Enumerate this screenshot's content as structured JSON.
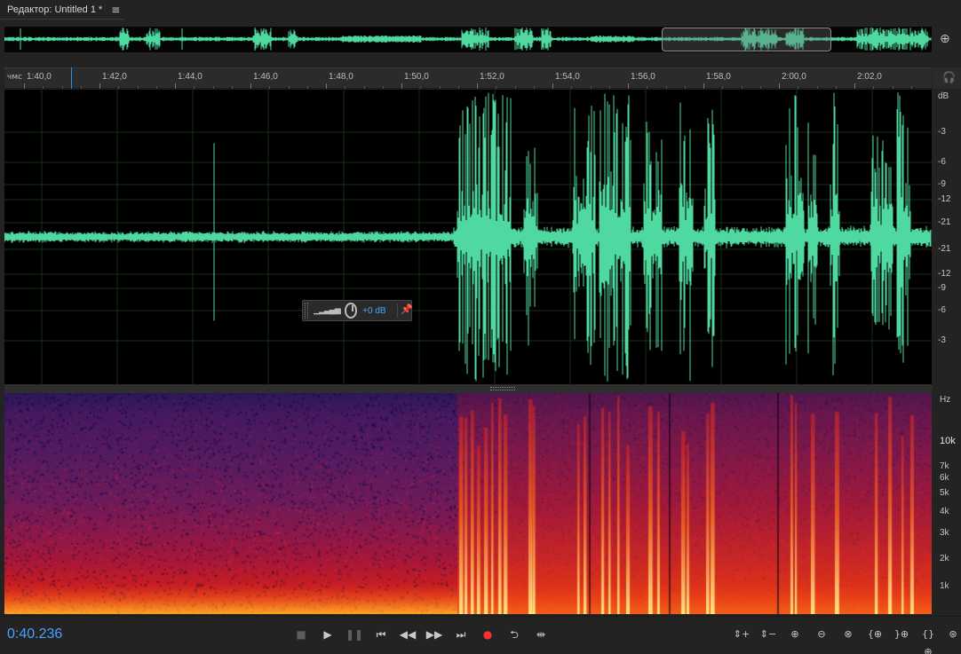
{
  "app": {
    "title": "Редактор: Untitled 1 *",
    "menu_icon": "hamburger-menu-icon"
  },
  "ruler": {
    "unit": "чмс",
    "ticks": [
      "1:40,0",
      "1:42,0",
      "1:44,0",
      "1:46,0",
      "1:48,0",
      "1:50,0",
      "1:52,0",
      "1:54,0",
      "1:56,0",
      "1:58,0",
      "2:00,0",
      "2:02,0"
    ]
  },
  "db_scale": {
    "unit": "dB",
    "labels": [
      "-3",
      "-6",
      "-9",
      "-12",
      "-21",
      "-21",
      "-12",
      "-9",
      "-6",
      "-3"
    ]
  },
  "hz_scale": {
    "unit": "Hz",
    "labels": [
      "10k",
      "7k",
      "6k",
      "5k",
      "4k",
      "3k",
      "2k",
      "1k"
    ]
  },
  "hud": {
    "value": "+0 dB"
  },
  "transport": {
    "current_time": "0:40.236"
  },
  "colors": {
    "waveform": "#4fd8a0",
    "accent": "#4a9fff",
    "record": "#ff2f2f",
    "background": "#000000"
  }
}
